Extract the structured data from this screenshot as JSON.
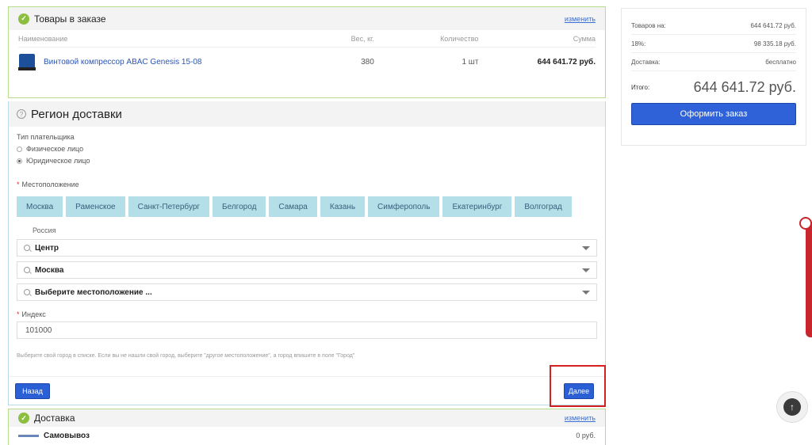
{
  "order": {
    "title": "Товары в заказе",
    "edit": "изменить",
    "columns": [
      "Наименование",
      "Вес, кг.",
      "Количество",
      "Сумма"
    ],
    "item": {
      "name": "Винтовой компрессор ABAC Genesis 15-08",
      "weight": "380",
      "qty": "1 шт",
      "sum": "644 641.72 руб."
    }
  },
  "region": {
    "step": "?",
    "title": "Регион доставки",
    "payer_label": "Тип плательщика",
    "payer_options": [
      "Физическое лицо",
      "Юридическое лицо"
    ],
    "location_label": "Местоположение",
    "cities": [
      "Москва",
      "Раменское",
      "Санкт-Петербург",
      "Белгород",
      "Самара",
      "Казань",
      "Симферополь",
      "Екатеринбург",
      "Волгоград"
    ],
    "country": "Россия",
    "selects": [
      "Центр",
      "Москва",
      "Выберите местоположение ..."
    ],
    "index_label": "Индекс",
    "index_value": "101000",
    "hint": "Выберите свой город в списке. Если вы не нашли свой город, выберите \"другое местоположение\", а город впишите в поле \"Город\"",
    "back": "Назад",
    "next": "Далее"
  },
  "delivery": {
    "title": "Доставка",
    "edit": "изменить",
    "method": "Самовывоз",
    "price": "0 руб."
  },
  "summary": {
    "rows": [
      {
        "k": "Товаров на:",
        "v": "644 641.72 руб."
      },
      {
        "k": "18%:",
        "v": "98 335.18 руб."
      },
      {
        "k": "Доставка:",
        "v": "бесплатно"
      }
    ],
    "total_label": "Итого:",
    "total_value": "644 641.72 руб.",
    "order_button": "Оформить заказ"
  }
}
